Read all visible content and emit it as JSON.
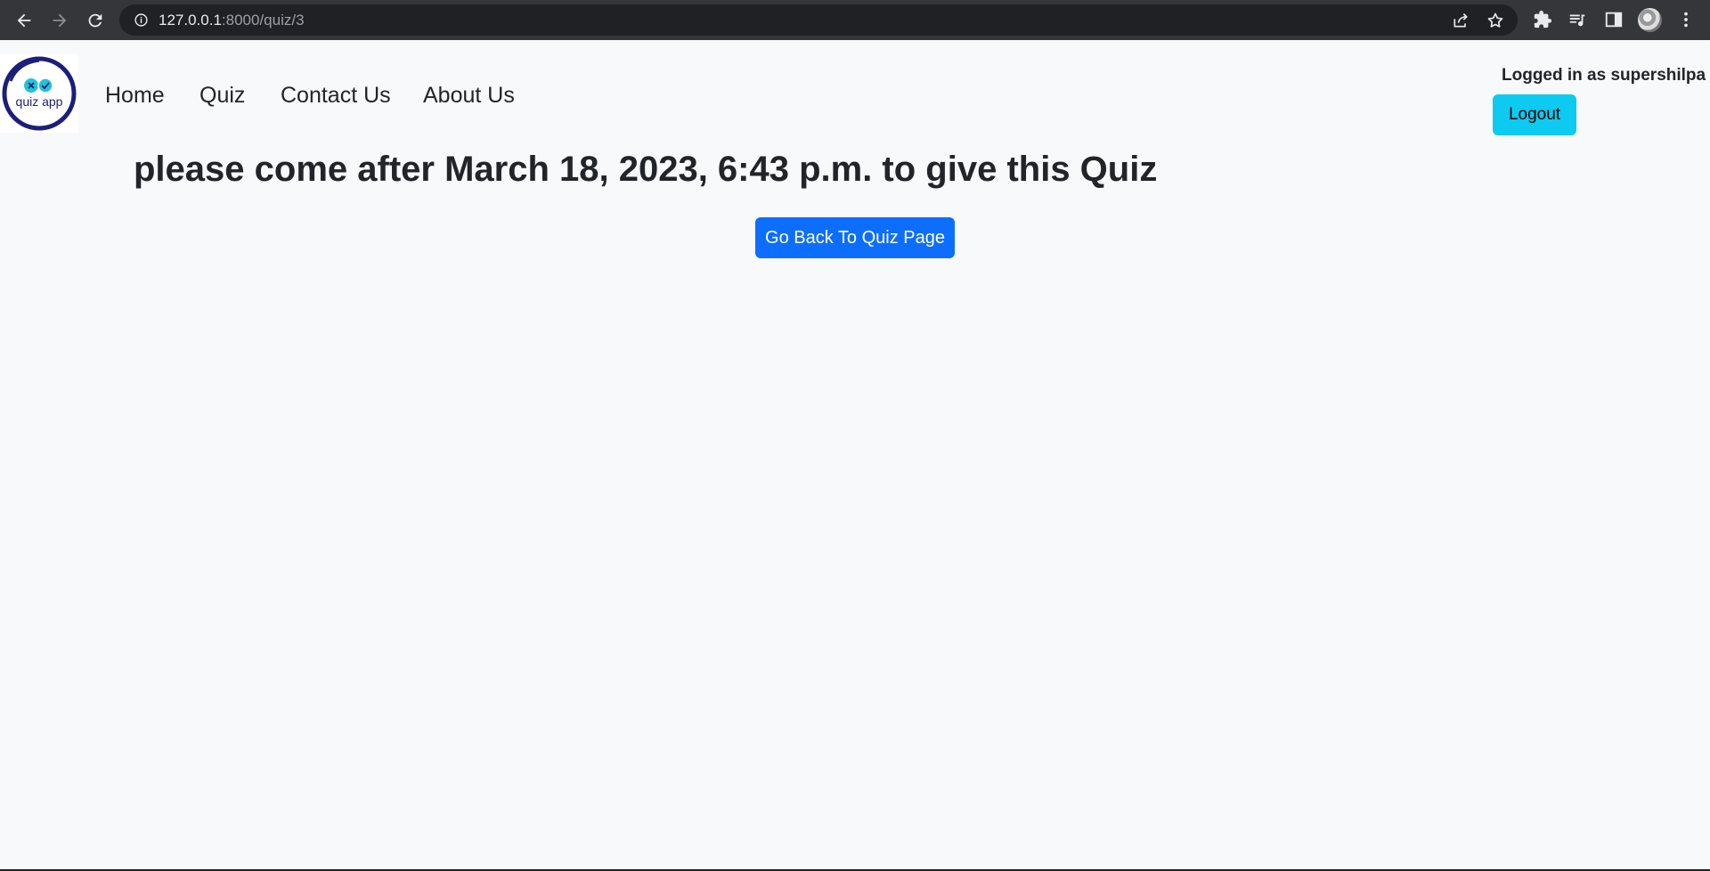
{
  "browser": {
    "url_host": "127.0.0.1",
    "url_path": ":8000/quiz/3"
  },
  "logo": {
    "text": "quiz app"
  },
  "nav": {
    "items": [
      {
        "label": "Home"
      },
      {
        "label": "Quiz"
      },
      {
        "label": "Contact Us"
      },
      {
        "label": "About Us"
      }
    ]
  },
  "user": {
    "status": "Logged in as supershilpa",
    "logout_label": "Logout"
  },
  "main": {
    "message": "please come after March 18, 2023, 6:43 p.m. to give this Quiz",
    "back_button_label": "Go Back To Quiz Page"
  },
  "colors": {
    "logout_button": "#0dcaf0",
    "primary_button": "#0d6efd",
    "page_background": "#f8f9fa"
  }
}
